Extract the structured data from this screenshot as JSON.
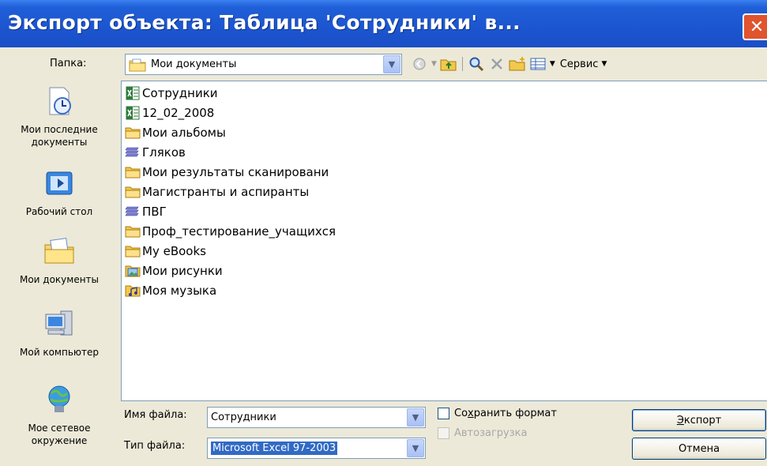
{
  "window": {
    "title": "Экспорт объекта: Таблица 'Сотрудники' в...",
    "close_glyph": "✕"
  },
  "folder": {
    "label": "Папка:",
    "value": "Мои документы"
  },
  "toolbar": {
    "service_label": "Сервис",
    "icons": [
      "back-icon",
      "up-folder-icon",
      "search-web-icon",
      "delete-icon",
      "new-folder-icon",
      "views-icon"
    ]
  },
  "places": [
    {
      "label": "Мои последние документы",
      "icon": "recent-documents-icon"
    },
    {
      "label": "Рабочий стол",
      "icon": "desktop-icon"
    },
    {
      "label": "Мои документы",
      "icon": "my-documents-icon"
    },
    {
      "label": "Мой компьютер",
      "icon": "my-computer-icon"
    },
    {
      "label": "Мое сетевое окружение",
      "icon": "network-places-icon"
    }
  ],
  "files": [
    {
      "name": "Сотрудники",
      "type": "excel"
    },
    {
      "name": "12_02_2008",
      "type": "excel"
    },
    {
      "name": "Мои альбомы",
      "type": "folder"
    },
    {
      "name": "Гляков",
      "type": "stack"
    },
    {
      "name": "Мои результаты сканировани",
      "type": "folder"
    },
    {
      "name": "Магистранты и аспиранты",
      "type": "folder"
    },
    {
      "name": "ПВГ",
      "type": "stack"
    },
    {
      "name": "Проф_тестирование_учащихся",
      "type": "folder"
    },
    {
      "name": "My eBooks",
      "type": "folder"
    },
    {
      "name": "Мои рисунки",
      "type": "pictures"
    },
    {
      "name": "Моя музыка",
      "type": "music"
    }
  ],
  "filename": {
    "label": "Имя файла:",
    "value": "Сотрудники"
  },
  "filetype": {
    "label": "Тип файла:",
    "value": "Microsoft Excel 97-2003"
  },
  "options": {
    "save_format": {
      "prefix": "Со",
      "accel": "х",
      "suffix": "ранить формат",
      "checked": false
    },
    "autostart": {
      "label": "Автозагрузка",
      "checked": false,
      "disabled": true
    }
  },
  "buttons": {
    "export": {
      "accel": "Э",
      "rest": "кспорт"
    },
    "cancel": "Отмена"
  },
  "colors": {
    "title_bar": "#1c55cf",
    "dialog_bg": "#ece9d8",
    "selection": "#316ac5",
    "close": "#e0542e"
  }
}
